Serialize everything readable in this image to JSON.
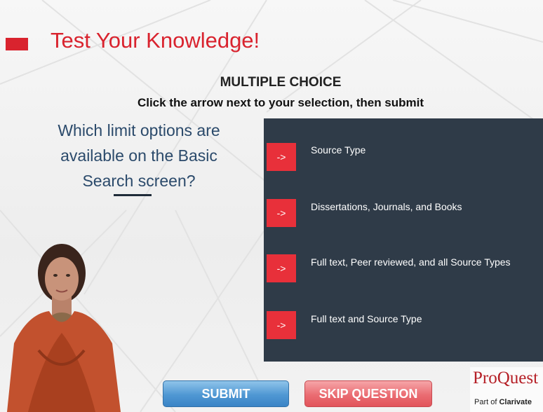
{
  "header": {
    "title": "Test Your Knowledge!"
  },
  "quiz": {
    "type_label": "MULTIPLE CHOICE",
    "instruction": "Click the arrow next to your selection, then submit",
    "question": "Which limit options are available on the Basic Search screen?",
    "options": [
      {
        "arrow": "->",
        "label": "Source Type"
      },
      {
        "arrow": "->",
        "label": "Dissertations, Journals, and Books"
      },
      {
        "arrow": "->",
        "label": "Full text, Peer reviewed, and all Source Types"
      },
      {
        "arrow": "->",
        "label": "Full text and Source Type"
      }
    ]
  },
  "actions": {
    "submit_label": "SUBMIT",
    "skip_label": "SKIP QUESTION"
  },
  "logo": {
    "main": "ProQuest",
    "sub_prefix": "Part of",
    "sub_brand": "Clarivate"
  },
  "colors": {
    "accent_red": "#d9232e",
    "panel": "#2f3b48",
    "question_text": "#2b4a6b",
    "submit_blue": "#4f97d3",
    "skip_pink": "#ea6c72"
  }
}
